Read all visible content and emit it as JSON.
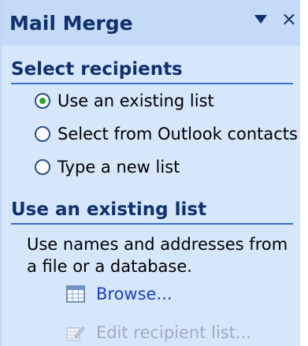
{
  "panel": {
    "title": "Mail Merge"
  },
  "select_recipients": {
    "heading": "Select recipients",
    "options": [
      {
        "label": "Use an existing list",
        "checked": true
      },
      {
        "label": "Select from Outlook contacts",
        "checked": false
      },
      {
        "label": "Type a new list",
        "checked": false
      }
    ]
  },
  "existing_list": {
    "heading": "Use an existing list",
    "description": "Use names and addresses from a file or a database.",
    "browse_label": "Browse...",
    "edit_label": "Edit recipient list..."
  },
  "colors": {
    "panel_bg": "#d6e6fb",
    "heading_text": "#10306e",
    "heading_rule": "#3a6fd2",
    "link": "#1c3fc2",
    "disabled": "#a3acbd",
    "radio_selected": "#2fa52f"
  },
  "icons": {
    "dropdown": "chevron-down-icon",
    "close": "close-icon",
    "browse": "table-grid-icon",
    "edit": "edit-list-icon"
  }
}
